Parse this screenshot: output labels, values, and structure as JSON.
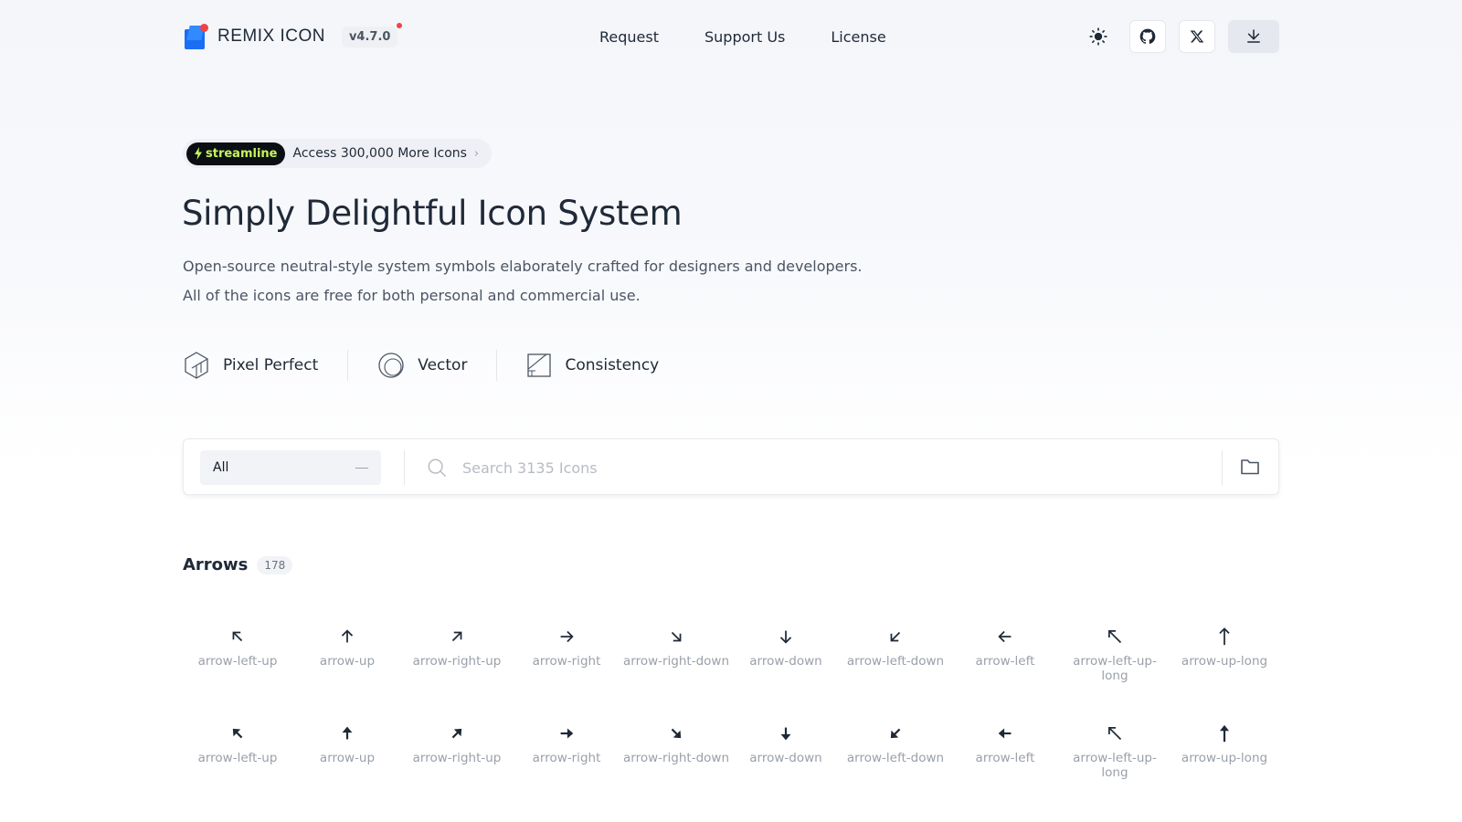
{
  "brand": {
    "name": "REMIX ICON",
    "version": "v4.7.0"
  },
  "nav": [
    "Request",
    "Support Us",
    "License"
  ],
  "promo": {
    "badge": "streamline",
    "text": "Access 300,000 More Icons"
  },
  "hero": {
    "title": "Simply Delightful Icon System",
    "subtitle_line1": "Open-source neutral-style system symbols elaborately crafted for designers and developers.",
    "subtitle_line2": "All of the icons are free for both personal and commercial use."
  },
  "features": [
    "Pixel Perfect",
    "Vector",
    "Consistency"
  ],
  "search": {
    "category": "All",
    "placeholder": "Search 3135 Icons"
  },
  "category": {
    "name": "Arrows",
    "count": "178"
  },
  "icons": [
    {
      "label": "arrow-left-up",
      "dir": 315,
      "style": "line"
    },
    {
      "label": "arrow-up",
      "dir": 0,
      "style": "line"
    },
    {
      "label": "arrow-right-up",
      "dir": 45,
      "style": "line"
    },
    {
      "label": "arrow-right",
      "dir": 90,
      "style": "line"
    },
    {
      "label": "arrow-right-down",
      "dir": 135,
      "style": "line"
    },
    {
      "label": "arrow-down",
      "dir": 180,
      "style": "line"
    },
    {
      "label": "arrow-left-down",
      "dir": 225,
      "style": "line"
    },
    {
      "label": "arrow-left",
      "dir": 270,
      "style": "line"
    },
    {
      "label": "arrow-left-up-long",
      "dir": 315,
      "style": "line-long"
    },
    {
      "label": "arrow-up-long",
      "dir": 0,
      "style": "line-long"
    },
    {
      "label": "arrow-left-up",
      "dir": 315,
      "style": "fill"
    },
    {
      "label": "arrow-up",
      "dir": 0,
      "style": "fill"
    },
    {
      "label": "arrow-right-up",
      "dir": 45,
      "style": "fill"
    },
    {
      "label": "arrow-right",
      "dir": 90,
      "style": "fill"
    },
    {
      "label": "arrow-right-down",
      "dir": 135,
      "style": "fill"
    },
    {
      "label": "arrow-down",
      "dir": 180,
      "style": "fill"
    },
    {
      "label": "arrow-left-down",
      "dir": 225,
      "style": "fill"
    },
    {
      "label": "arrow-left",
      "dir": 270,
      "style": "fill"
    },
    {
      "label": "arrow-left-up-long",
      "dir": 315,
      "style": "line-long"
    },
    {
      "label": "arrow-up-long",
      "dir": 0,
      "style": "fill-long"
    }
  ],
  "colors": {
    "accent": "#1b6ef3",
    "dot": "#ef4444",
    "streamline": "#c7f45b"
  }
}
